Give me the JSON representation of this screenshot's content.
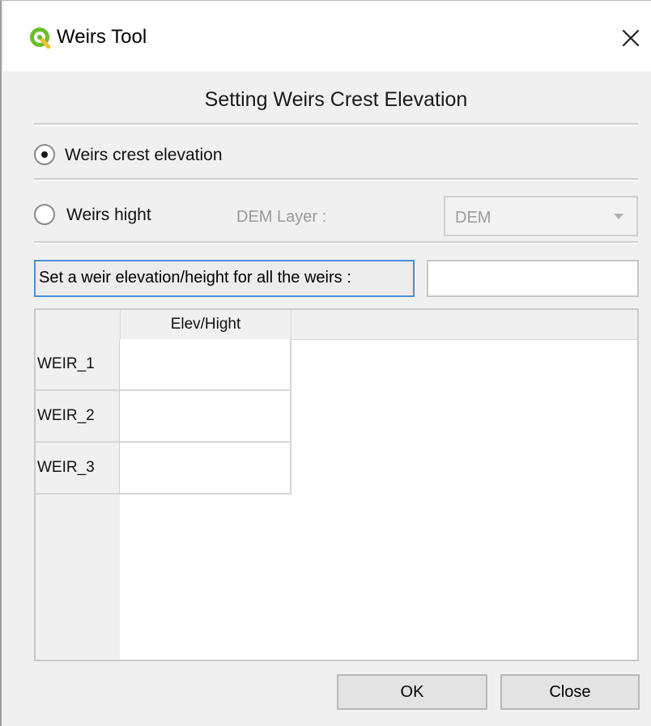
{
  "window": {
    "title": "Weirs Tool",
    "icon": "qgis-logo-icon",
    "close_icon": "close-icon"
  },
  "heading": "Setting Weirs Crest Elevation",
  "options": {
    "crest_elevation_label": "Weirs crest elevation",
    "crest_elevation_selected": true,
    "height_label": "Weirs hight",
    "height_selected": false,
    "dem_layer_label": "DEM Layer :",
    "dem_layer_value": "DEM"
  },
  "set_all": {
    "button_label": "Set a weir elevation/height for all the weirs :",
    "input_value": ""
  },
  "table": {
    "column_header": "Elev/Hight",
    "rows": [
      {
        "name": "WEIR_1",
        "value": ""
      },
      {
        "name": "WEIR_2",
        "value": ""
      },
      {
        "name": "WEIR_3",
        "value": ""
      }
    ]
  },
  "buttons": {
    "ok_label": "OK",
    "close_label": "Close"
  },
  "colors": {
    "focus_border": "#4a8fd6",
    "qgis_green": "#6bbf2a",
    "qgis_yellow": "#f2c12e"
  }
}
